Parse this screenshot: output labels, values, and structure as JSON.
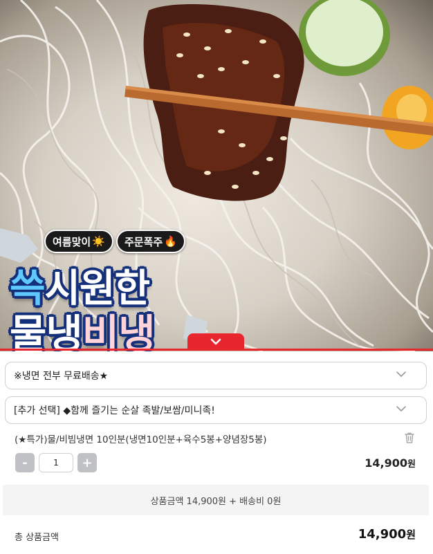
{
  "hero": {
    "badge_1_text": "여름맞이",
    "badge_1_emoji": "☀️",
    "badge_2_text": "주문폭주",
    "badge_2_emoji": "🔥",
    "headline_accent": "쓱",
    "headline_line1": "시원한",
    "headline_line2_a": "물냉",
    "headline_line2_b": "비냉",
    "expand_icon": "chevron-down-icon"
  },
  "options": {
    "select_1": "※냉면 전부 무료배송★",
    "select_2": "[추가 선택] ◆함께 즐기는 순살 족발/보쌈/미니족!",
    "dropdown_icon": "chevron-down-icon"
  },
  "cart_item": {
    "title": "(★특가)물/비빔냉면 10인분(냉면10인분+육수5봉+양념장5봉)",
    "minus": "-",
    "plus": "+",
    "quantity": "1",
    "price": "14,900",
    "currency": "원",
    "delete_icon": "trash-icon"
  },
  "summary": {
    "text": "상품금액 14,900원 + 배송비 0원"
  },
  "total": {
    "label": "총 상품금액",
    "price": "14,900",
    "currency": "원"
  },
  "colors": {
    "accent_red": "#e8262e",
    "headline_outline": "#15307a",
    "headline_accent": "#5ec8ff"
  }
}
